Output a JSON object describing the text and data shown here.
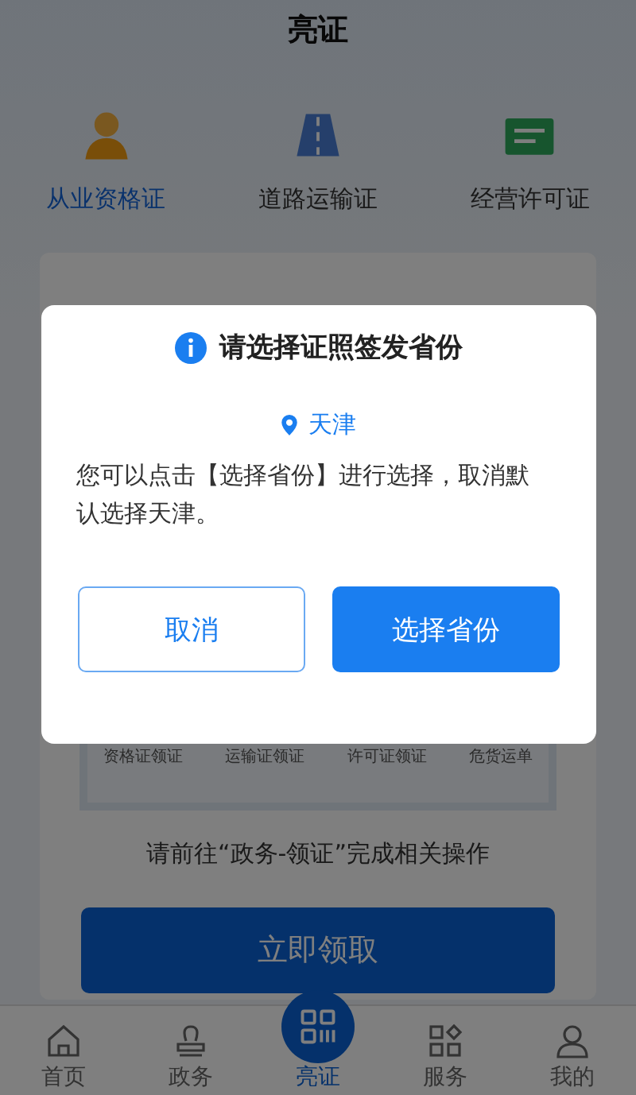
{
  "header": {
    "title": "亮证"
  },
  "categories": [
    {
      "label": "从业资格证",
      "selected": true,
      "kind": "person"
    },
    {
      "label": "道路运输证",
      "selected": false,
      "kind": "road"
    },
    {
      "label": "经营许可证",
      "selected": false,
      "kind": "license"
    }
  ],
  "card": {
    "items": [
      "资格证领证",
      "运输证领证",
      "许可证领证",
      "危货运单"
    ],
    "hint": "请前往“政务-领证”完成相关操作",
    "button": "立即领取"
  },
  "tabbar": [
    {
      "label": "首页",
      "selected": false,
      "kind": "home"
    },
    {
      "label": "政务",
      "selected": false,
      "kind": "stamp"
    },
    {
      "label": "亮证",
      "selected": true,
      "kind": "qr"
    },
    {
      "label": "服务",
      "selected": false,
      "kind": "grid"
    },
    {
      "label": "我的",
      "selected": false,
      "kind": "person"
    }
  ],
  "dialog": {
    "title": "请选择证照签发省份",
    "location": "天津",
    "message": "您可以点击【选择省份】进行选择，取消默认选择天津。",
    "cancel": "取消",
    "confirm": "选择省份"
  }
}
